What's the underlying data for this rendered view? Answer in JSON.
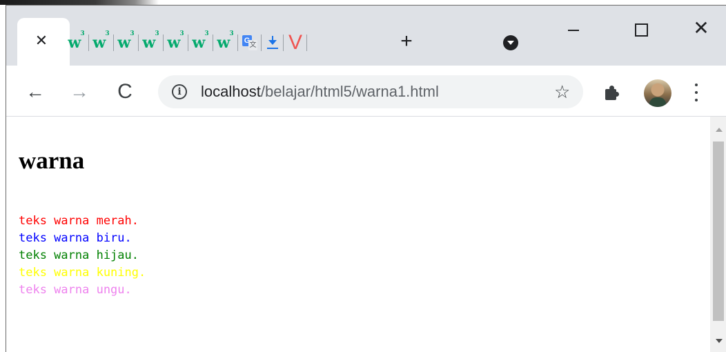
{
  "browser": {
    "tabs": {
      "active_close": "✕",
      "w3_letter": "w",
      "w3_super": "3",
      "translate_a": "G",
      "translate_b": "文",
      "v_letter": "V",
      "new_tab": "+",
      "w3_tab_count": 7
    },
    "window_controls": {
      "close": "✕"
    },
    "nav": {
      "back": "←",
      "forward": "→",
      "reload": "C"
    },
    "omnibox": {
      "info": "i",
      "url_host": "localhost",
      "url_path": "/belajar/html5/warna1.html",
      "star": "☆"
    }
  },
  "page": {
    "heading": "warna",
    "lines": [
      {
        "text": "teks warna merah.",
        "color": "#ff0000"
      },
      {
        "text": "teks warna biru.",
        "color": "#0000ff"
      },
      {
        "text": "teks warna hijau.",
        "color": "#008000"
      },
      {
        "text": "teks warna kuning.",
        "color": "#ffff00"
      },
      {
        "text": "teks warna ungu.",
        "color": "#ee82ee"
      }
    ]
  },
  "colors": {
    "tabstrip_bg": "#dee1e6",
    "w3_green": "#04aa6d",
    "scrollbar_thumb": "#c1c1c1"
  }
}
